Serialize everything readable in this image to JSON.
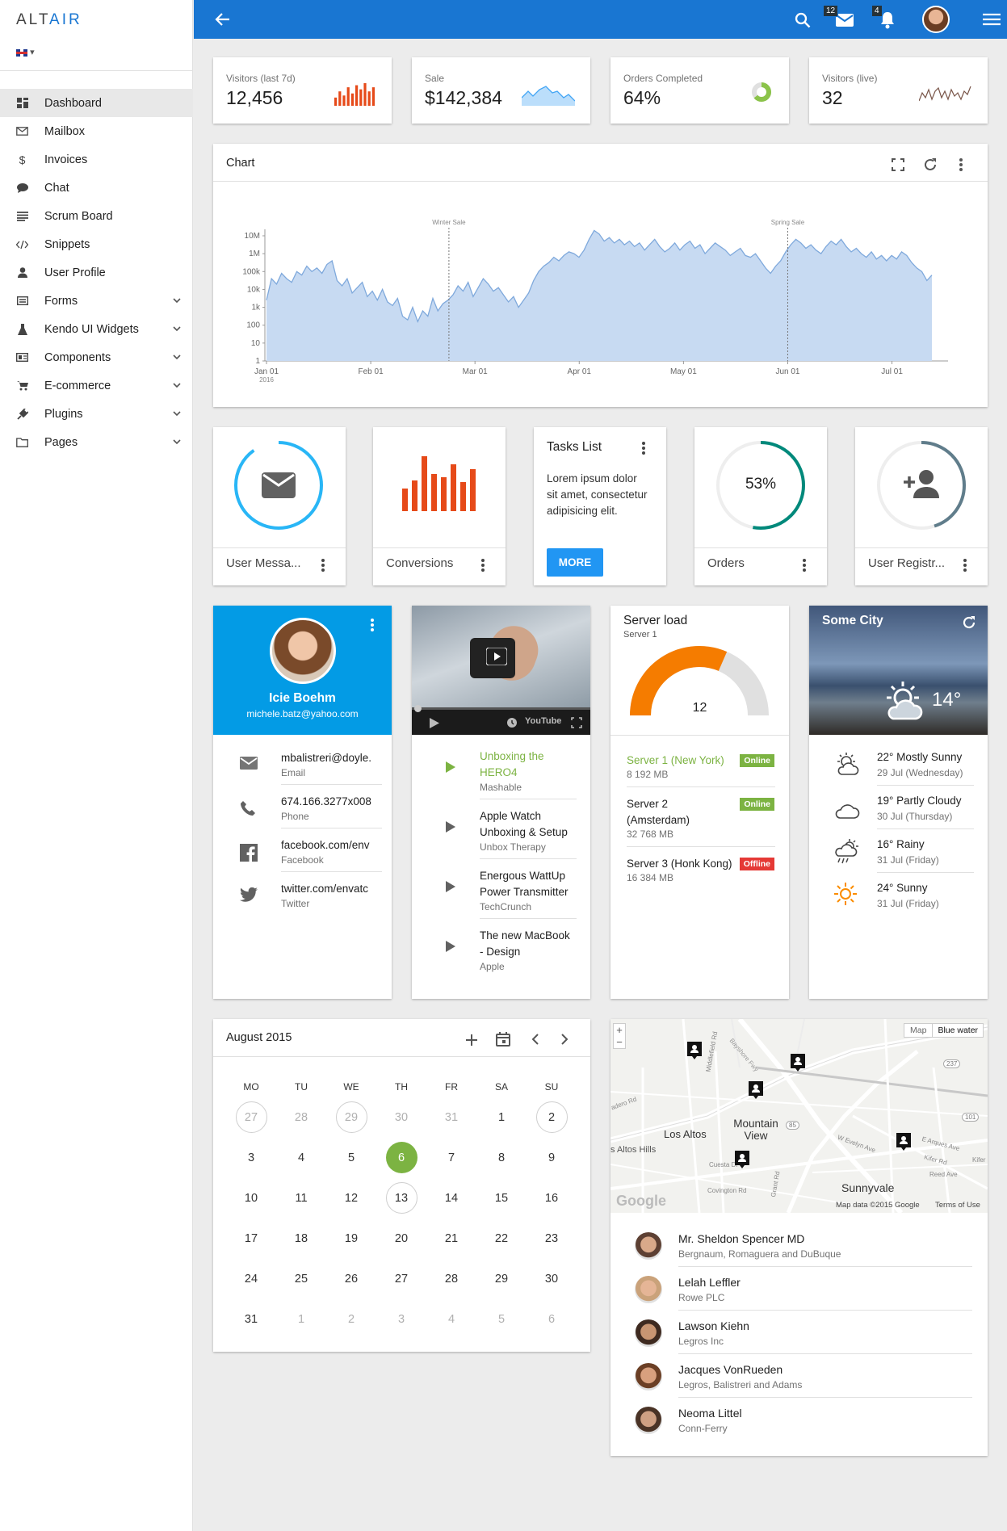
{
  "app": {
    "logo_a": "ALT",
    "logo_b": "AIR"
  },
  "sidebar": {
    "items": [
      {
        "label": "Dashboard",
        "icon": "dashboard-icon",
        "active": true
      },
      {
        "label": "Mailbox",
        "icon": "mail-icon"
      },
      {
        "label": "Invoices",
        "icon": "dollar-icon"
      },
      {
        "label": "Chat",
        "icon": "chat-bubble-icon"
      },
      {
        "label": "Scrum Board",
        "icon": "board-icon"
      },
      {
        "label": "Snippets",
        "icon": "code-icon"
      },
      {
        "label": "User Profile",
        "icon": "person-icon"
      },
      {
        "label": "Forms",
        "icon": "form-icon",
        "expand": true
      },
      {
        "label": "Kendo UI Widgets",
        "icon": "flask-icon",
        "expand": true
      },
      {
        "label": "Components",
        "icon": "components-icon",
        "expand": true
      },
      {
        "label": "E-commerce",
        "icon": "cart-icon",
        "expand": true
      },
      {
        "label": "Plugins",
        "icon": "plug-icon",
        "expand": true
      },
      {
        "label": "Pages",
        "icon": "folder-icon",
        "expand": true
      }
    ]
  },
  "header": {
    "mail_count": "12",
    "notif_count": "4"
  },
  "stats": [
    {
      "label": "Visitors (last 7d)",
      "value": "12,456",
      "bars": [
        4,
        7,
        5,
        9,
        6,
        10,
        8,
        11,
        7,
        9
      ]
    },
    {
      "label": "Sale",
      "value": "$142,384"
    },
    {
      "label": "Orders Completed",
      "value": "64%",
      "percent": 64
    },
    {
      "label": "Visitors (live)",
      "value": "32"
    }
  ],
  "chart_card": {
    "title": "Chart"
  },
  "chart_data": {
    "type": "area",
    "title": "Chart",
    "y_scale": "log",
    "y_ticks": [
      "1",
      "10",
      "100",
      "1k",
      "10k",
      "100k",
      "1M",
      "10M"
    ],
    "x_ticks": [
      "Jan 01",
      "Feb 01",
      "Mar 01",
      "Apr 01",
      "May 01",
      "Jun 01",
      "Jul 01"
    ],
    "x_year": "2016",
    "annotations": [
      {
        "label": "Winter Sale",
        "at": "Feb 24"
      },
      {
        "label": "Spring Sale",
        "at": "Jun 01"
      }
    ],
    "values": [
      3.4,
      4.6,
      4.3,
      4.9,
      4.6,
      4.4,
      5.0,
      4.8,
      5.3,
      5.0,
      5.2,
      4.9,
      5.4,
      5.6,
      4.5,
      4.2,
      4.6,
      3.8,
      4.1,
      4.4,
      3.6,
      3.9,
      3.4,
      4.0,
      3.3,
      3.1,
      3.5,
      2.5,
      2.3,
      3.0,
      2.2,
      2.8,
      2.5,
      3.5,
      2.8,
      3.2,
      3.4,
      3.7,
      4.2,
      3.9,
      4.4,
      3.6,
      4.1,
      4.6,
      4.3,
      3.9,
      4.1,
      3.7,
      3.3,
      3.6,
      3.0,
      3.4,
      3.8,
      4.5,
      5.0,
      5.3,
      5.5,
      5.8,
      5.6,
      5.9,
      6.1,
      6.0,
      5.8,
      6.2,
      6.8,
      7.3,
      7.1,
      6.7,
      6.9,
      6.6,
      6.8,
      6.5,
      6.7,
      6.4,
      6.6,
      6.2,
      6.5,
      6.8,
      6.4,
      6.1,
      6.3,
      6.6,
      6.2,
      6.5,
      6.7,
      6.3,
      6.5,
      6.0,
      6.3,
      6.6,
      6.4,
      6.2,
      5.9,
      6.1,
      6.3,
      5.9,
      5.8,
      6.0,
      5.6,
      5.2,
      4.9,
      5.3,
      5.6,
      6.1,
      6.5,
      6.8,
      6.6,
      6.3,
      6.5,
      6.2,
      6.0,
      6.4,
      6.7,
      6.5,
      6.8,
      6.4,
      6.1,
      6.3,
      6.0,
      5.8,
      6.1,
      5.7,
      5.9,
      5.6,
      5.9,
      5.7,
      6.1,
      5.9,
      5.5,
      5.2,
      5.0,
      4.5,
      4.8
    ]
  },
  "tiles": [
    {
      "label": "User Messa...",
      "icon": "mail-icon"
    },
    {
      "label": "Conversions"
    },
    {
      "title": "Tasks List",
      "text": "Lorem ipsum dolor sit amet, consectetur adipisicing elit.",
      "button": "MORE"
    },
    {
      "label": "Orders",
      "value": "53%"
    },
    {
      "label": "User Registr...",
      "icon": "person-add-icon"
    }
  ],
  "profile": {
    "name": "Icie Boehm",
    "email": "michele.batz@yahoo.com",
    "rows": [
      {
        "value": "mbalistreri@doyle.",
        "caption": "Email",
        "icon": "mail-icon"
      },
      {
        "value": "674.166.3277x008",
        "caption": "Phone",
        "icon": "phone-icon"
      },
      {
        "value": "facebook.com/env",
        "caption": "Facebook",
        "icon": "facebook-icon"
      },
      {
        "value": "twitter.com/envatc",
        "caption": "Twitter",
        "icon": "twitter-icon"
      }
    ]
  },
  "video": {
    "brand": "YouTube",
    "playlist": [
      {
        "title": "Unboxing the HERO4",
        "source": "Mashable",
        "active": true
      },
      {
        "title": "Apple Watch Unboxing & Setup",
        "source": "Unbox Therapy"
      },
      {
        "title": "Energous WattUp Power Transmitter",
        "source": "TechCrunch"
      },
      {
        "title": "The new MacBook - Design",
        "source": "Apple"
      }
    ]
  },
  "server": {
    "title": "Server load",
    "subtitle": "Server 1",
    "value": "12",
    "servers": [
      {
        "name": "Server 1 (New York)",
        "size": "8 192 MB",
        "status": "Online",
        "active": true
      },
      {
        "name": "Server 2 (Amsterdam)",
        "size": "32 768 MB",
        "status": "Online"
      },
      {
        "name": "Server 3 (Honk Kong)",
        "size": "16 384 MB",
        "status": "Offline"
      }
    ]
  },
  "weather": {
    "city": "Some City",
    "temp": "14°",
    "days": [
      {
        "title": "22° Mostly Sunny",
        "date": "29 Jul (Wednesday)",
        "icon": "partly-sunny-icon"
      },
      {
        "title": "19° Partly Cloudy",
        "date": "30 Jul (Thursday)",
        "icon": "cloud-icon"
      },
      {
        "title": "16° Rainy",
        "date": "31 Jul (Friday)",
        "icon": "rain-icon"
      },
      {
        "title": "24° Sunny",
        "date": "31 Jul (Friday)",
        "icon": "sun-icon"
      }
    ]
  },
  "calendar": {
    "title": "August 2015",
    "weekdays": [
      "MO",
      "TU",
      "WE",
      "TH",
      "FR",
      "SA",
      "SU"
    ],
    "weeks": [
      [
        "27",
        "28",
        "29",
        "30",
        "31",
        "1",
        "2"
      ],
      [
        "3",
        "4",
        "5",
        "6",
        "7",
        "8",
        "9"
      ],
      [
        "10",
        "11",
        "12",
        "13",
        "14",
        "15",
        "16"
      ],
      [
        "17",
        "18",
        "19",
        "20",
        "21",
        "22",
        "23"
      ],
      [
        "24",
        "25",
        "26",
        "27",
        "28",
        "29",
        "30"
      ],
      [
        "31",
        "1",
        "2",
        "3",
        "4",
        "5",
        "6"
      ]
    ]
  },
  "map": {
    "btn_map": "Map",
    "btn_water": "Blue water",
    "labels": [
      "Mountain View",
      "Los Altos",
      "Sunnyvale",
      "s Altos Hills"
    ],
    "streets": [
      "Bayshore Fwy",
      "W Evelyn Ave",
      "E Arques Ave",
      "Kifer Rd",
      "Reed Ave",
      "Grant Rd",
      "Cuesta Dr",
      "Covington Rd",
      "adero Rd",
      "Middlefield Rd",
      "Kifer"
    ],
    "shields": [
      "85",
      "101",
      "237"
    ],
    "watermark": "Google",
    "attribution": "Map data ©2015 Google",
    "terms": "Terms of Use",
    "zoom_in": "+",
    "zoom_out": "−"
  },
  "contacts": [
    {
      "name": "Mr. Sheldon Spencer MD",
      "company": "Bergnaum, Romaguera and DuBuque"
    },
    {
      "name": "Lelah Leffler",
      "company": "Rowe PLC"
    },
    {
      "name": "Lawson Kiehn",
      "company": "Legros Inc"
    },
    {
      "name": "Jacques VonRueden",
      "company": "Legros, Balistreri and Adams"
    },
    {
      "name": "Neoma Littel",
      "company": "Conn-Ferry"
    }
  ]
}
